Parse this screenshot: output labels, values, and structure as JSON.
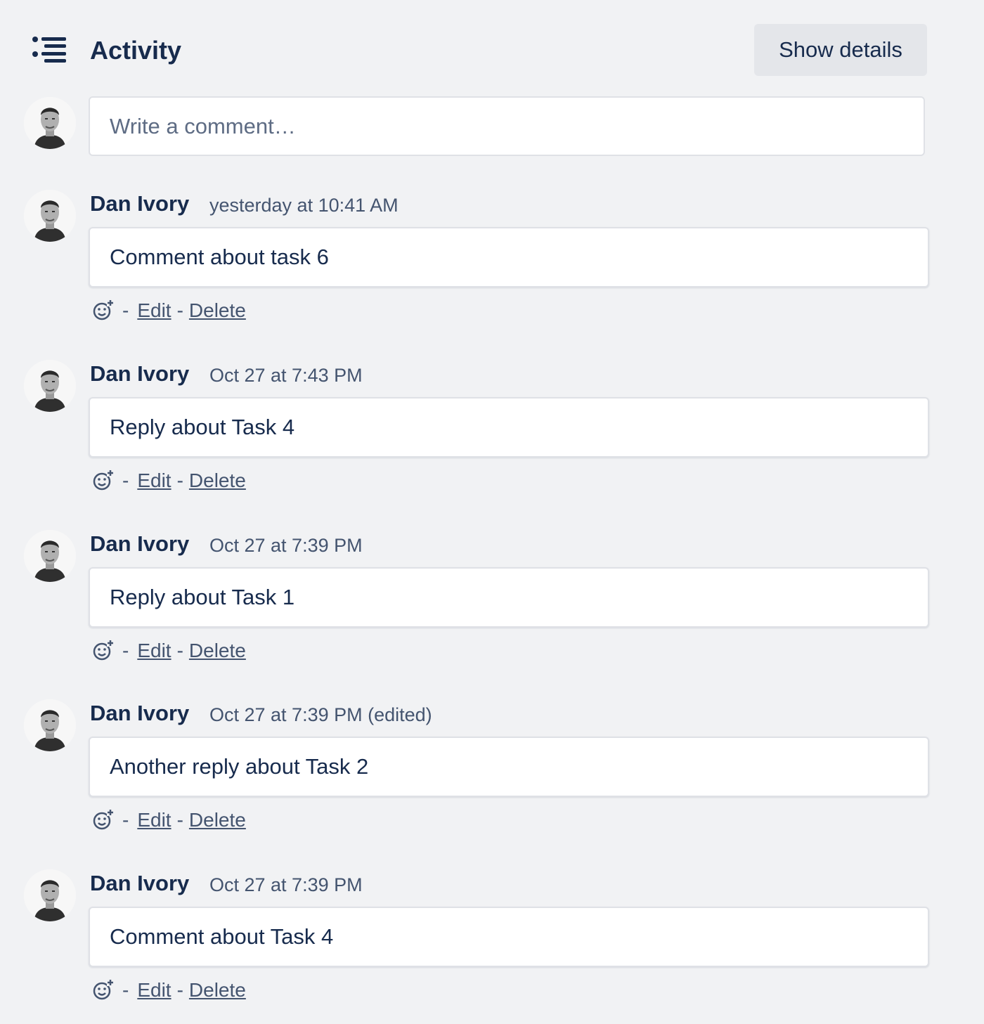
{
  "header": {
    "icon": "activity-list-icon",
    "title": "Activity",
    "show_details_label": "Show details"
  },
  "new_comment": {
    "placeholder": "Write a comment…",
    "avatar_icon": "user-avatar"
  },
  "actions": {
    "reaction_icon": "add-reaction-icon",
    "separator": "-",
    "edit_label": "Edit",
    "delete_label": "Delete"
  },
  "comments": [
    {
      "author": "Dan Ivory",
      "timestamp": "yesterday at 10:41 AM",
      "text": "Comment about task 6"
    },
    {
      "author": "Dan Ivory",
      "timestamp": "Oct 27 at 7:43 PM",
      "text": "Reply about Task 4"
    },
    {
      "author": "Dan Ivory",
      "timestamp": "Oct 27 at 7:39 PM",
      "text": "Reply about Task 1"
    },
    {
      "author": "Dan Ivory",
      "timestamp": "Oct 27 at 7:39 PM (edited)",
      "text": "Another reply about Task 2"
    },
    {
      "author": "Dan Ivory",
      "timestamp": "Oct 27 at 7:39 PM",
      "text": "Comment about Task 4"
    }
  ],
  "colors": {
    "background": "#f1f2f4",
    "text": "#172b4d",
    "subtle_text": "#44546f",
    "button_bg": "#e4e6ea"
  }
}
